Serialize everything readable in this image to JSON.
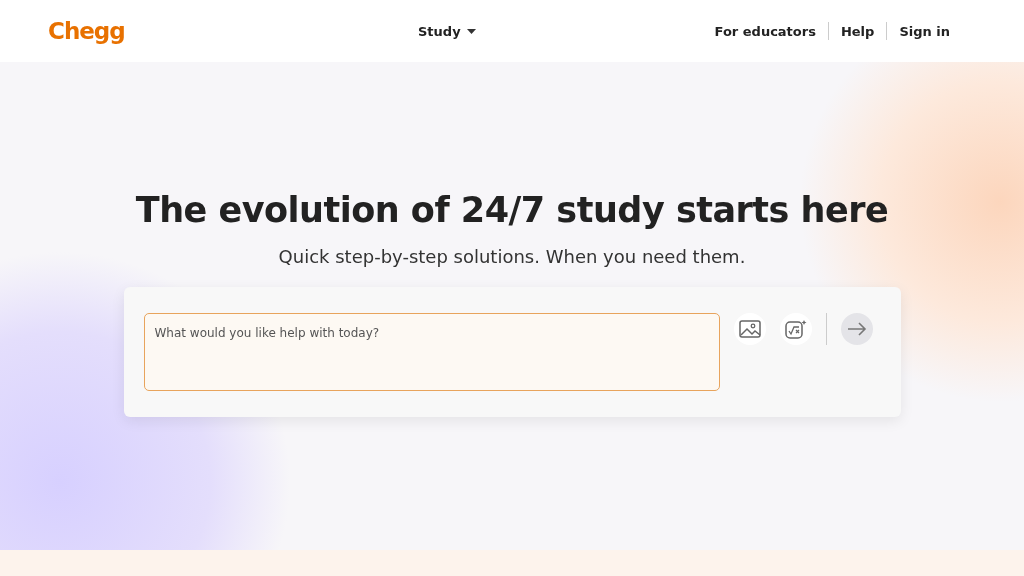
{
  "header": {
    "logo": "Chegg",
    "nav": [
      {
        "label": "Study",
        "kind": "dropdown"
      }
    ],
    "links": [
      "For educators",
      "Help",
      "Sign in"
    ]
  },
  "hero": {
    "title": "The evolution of 24/7 study starts here",
    "subtitle": "Quick step-by-step solutions. When you need them.",
    "question_box": {
      "placeholder": "What would you like help with today?"
    },
    "submit": {
      "disabled": true
    }
  }
}
